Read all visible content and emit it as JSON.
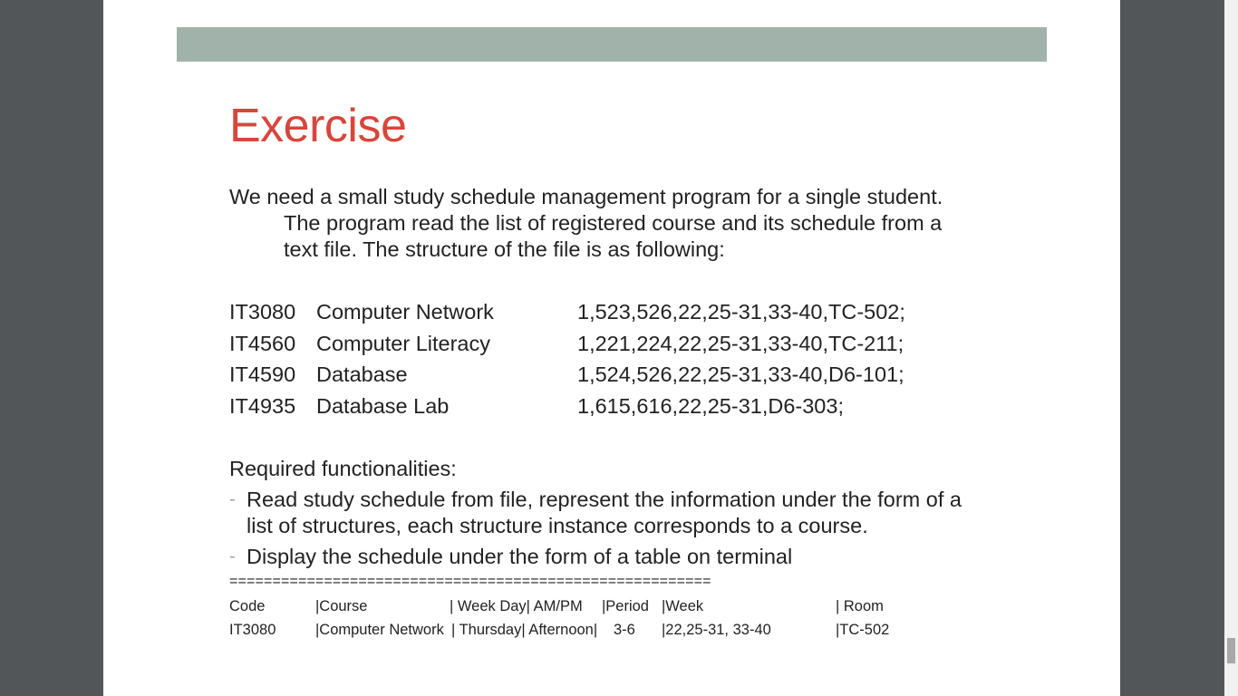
{
  "slide": {
    "title": "Exercise",
    "intro_line1": "We need a small study schedule management program for a single student.",
    "intro_rest": "The program read the list of registered course and its schedule from a text file. The structure of the file is as following:",
    "courses": [
      {
        "code": "IT3080",
        "name": "Computer Network",
        "schedule": "1,523,526,22,25-31,33-40,TC-502;"
      },
      {
        "code": "IT4560",
        "name": "Computer Literacy",
        "schedule": "1,221,224,22,25-31,33-40,TC-211;"
      },
      {
        "code": "IT4590",
        "name": "Database",
        "schedule": "1,524,526,22,25-31,33-40,D6-101;"
      },
      {
        "code": "IT4935",
        "name": "Database Lab",
        "schedule": "1,615,616,22,25-31,D6-303;"
      }
    ],
    "requirements_heading": "Required functionalities:",
    "bullets": [
      "Read study schedule from file, represent the information under the form of a list of structures, each structure instance corresponds to a course.",
      "Display the schedule under the form of a table on terminal"
    ],
    "bullet_marker": "-",
    "separator": "========================================================",
    "table_header": {
      "code": "Code",
      "course": "|Course",
      "week_day": "| Week Day| AM/PM",
      "period": "|Period",
      "week": "|Week",
      "room": "| Room"
    },
    "table_row": {
      "code": "IT3080",
      "course": "|Computer Network",
      "week_day": "| Thursday| Afternoon|",
      "period": "3-6",
      "week": "|22,25-31, 33-40",
      "room": "|TC-502"
    }
  },
  "colors": {
    "viewer_bg": "#525659",
    "banner": "#a0b2aa",
    "title": "#d9453b",
    "text": "#222222"
  }
}
